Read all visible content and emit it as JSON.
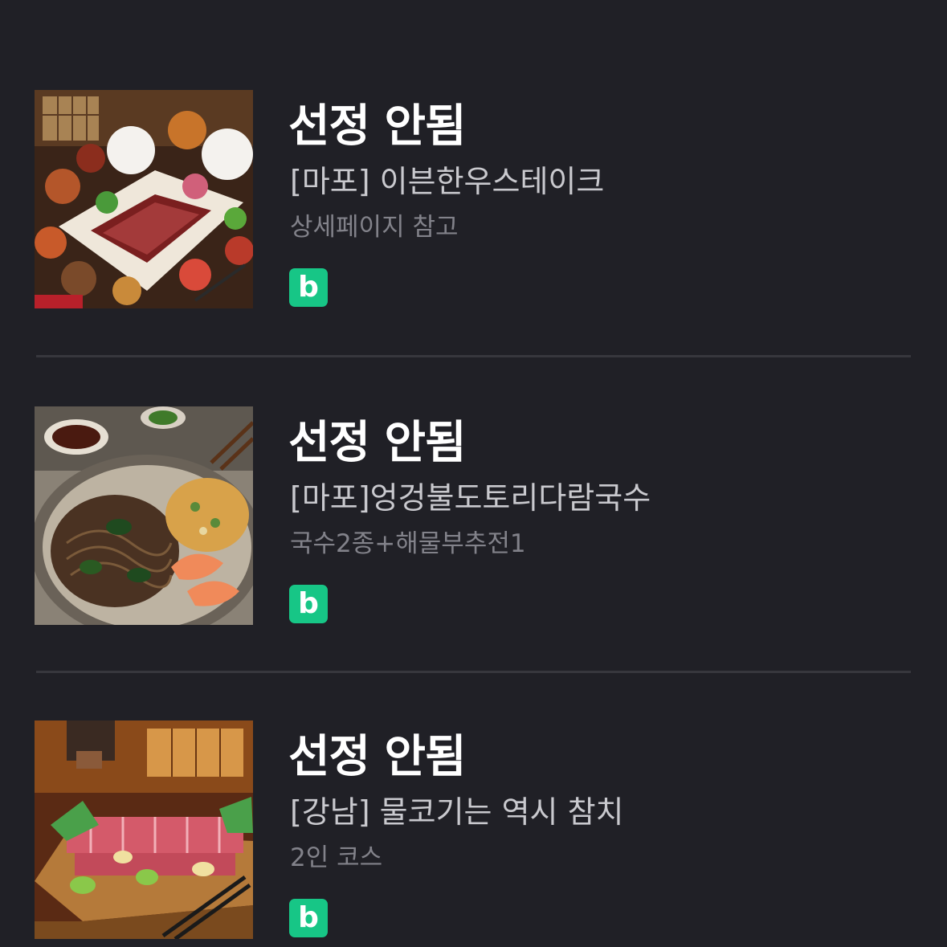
{
  "items": [
    {
      "status": "선정 안됨",
      "title": "[마포] 이븐한우스테이크",
      "subtitle": "상세페이지 참고",
      "badge": "b",
      "badge_color": "#17c686",
      "image": "korean-beef-steak-table-photo"
    },
    {
      "status": "선정 안됨",
      "title": "[마포]엉겅불도토리다람국수",
      "subtitle": "국수2종+해물부추전1",
      "badge": "b",
      "badge_color": "#17c686",
      "image": "buckwheat-noodles-seafood-pancake-photo"
    },
    {
      "status": "선정 안됨",
      "title": "[강남] 물코기는 역시 참치",
      "subtitle": "2인 코스",
      "badge": "b",
      "badge_color": "#17c686",
      "image": "tuna-sashimi-platter-photo"
    }
  ],
  "colors": {
    "background": "#202026",
    "status_text": "#ffffff",
    "title_text": "#c9c9ce",
    "subtitle_text": "#82828a",
    "divider": "#37373d",
    "badge": "#17c686"
  }
}
